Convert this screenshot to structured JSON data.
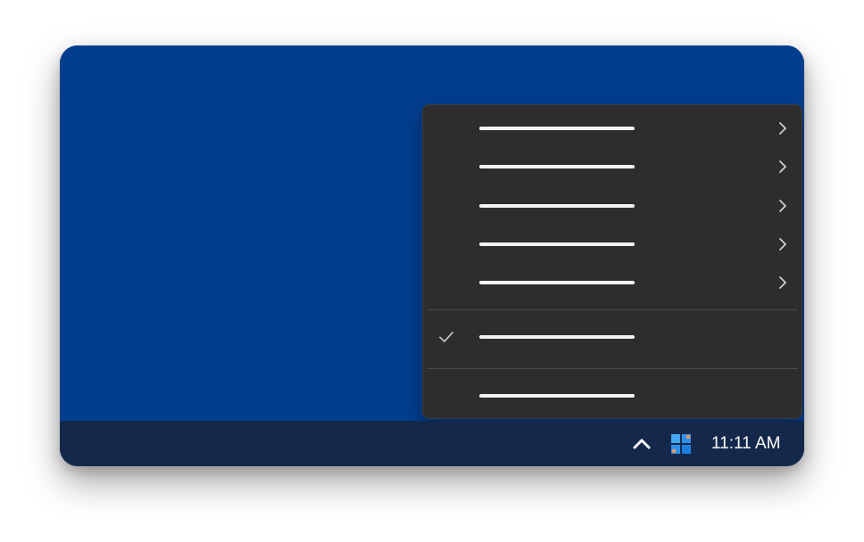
{
  "taskbar": {
    "clock": "11:11 AM",
    "tray_chevron_icon": "chevron-up-icon",
    "tray_app_icon": "windows-logo-icon"
  },
  "context_menu": {
    "items": [
      {
        "label": "",
        "has_submenu": true,
        "checked": false
      },
      {
        "label": "",
        "has_submenu": true,
        "checked": false
      },
      {
        "label": "",
        "has_submenu": true,
        "checked": false
      },
      {
        "label": "",
        "has_submenu": true,
        "checked": false
      },
      {
        "label": "",
        "has_submenu": true,
        "checked": false
      },
      {
        "label": "",
        "has_submenu": false,
        "checked": true
      },
      {
        "label": "",
        "has_submenu": false,
        "checked": false
      }
    ],
    "icons": {
      "submenu": "chevron-right-icon",
      "check": "checkmark-icon"
    }
  },
  "colors": {
    "desktop": "#023e8e",
    "taskbar": "#14284b",
    "menu_background": "#2d2d2d",
    "menu_text": "#f2f2f2",
    "divider": "#4a4a4a"
  }
}
